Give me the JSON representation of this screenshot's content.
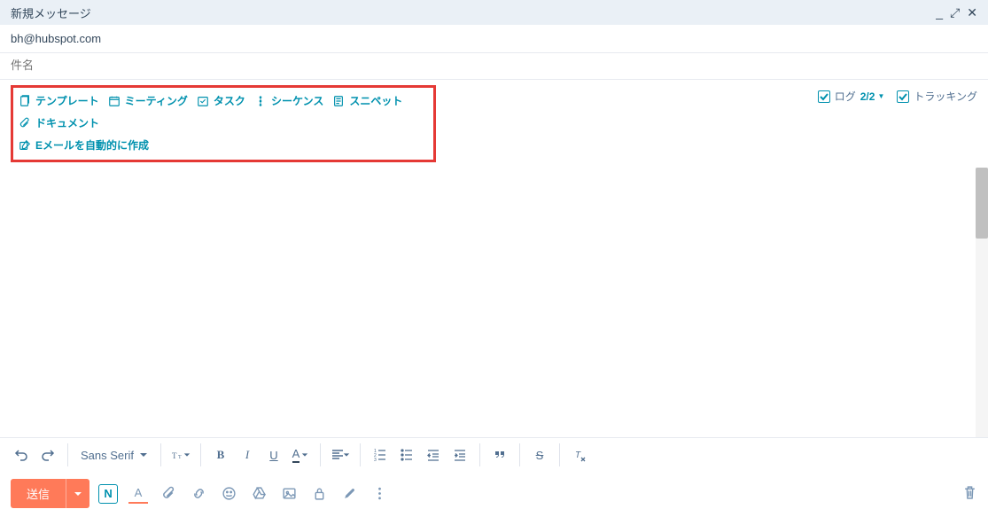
{
  "titlebar": {
    "title": "新規メッセージ"
  },
  "recipient": "bh@hubspot.com",
  "subject": {
    "placeholder": "件名",
    "value": ""
  },
  "tools": {
    "template": "テンプレート",
    "meeting": "ミーティング",
    "task": "タスク",
    "sequence": "シーケンス",
    "snippet": "スニペット",
    "document": "ドキュメント",
    "auto_email": "Eメールを自動的に作成"
  },
  "right_controls": {
    "log_label": "ログ",
    "log_count": "2/2",
    "tracking_label": "トラッキング"
  },
  "font_family": "Sans Serif",
  "send_button": "送信",
  "colors": {
    "accent": "#0091ae",
    "send": "#ff7a59",
    "highlight_border": "#e53935"
  }
}
